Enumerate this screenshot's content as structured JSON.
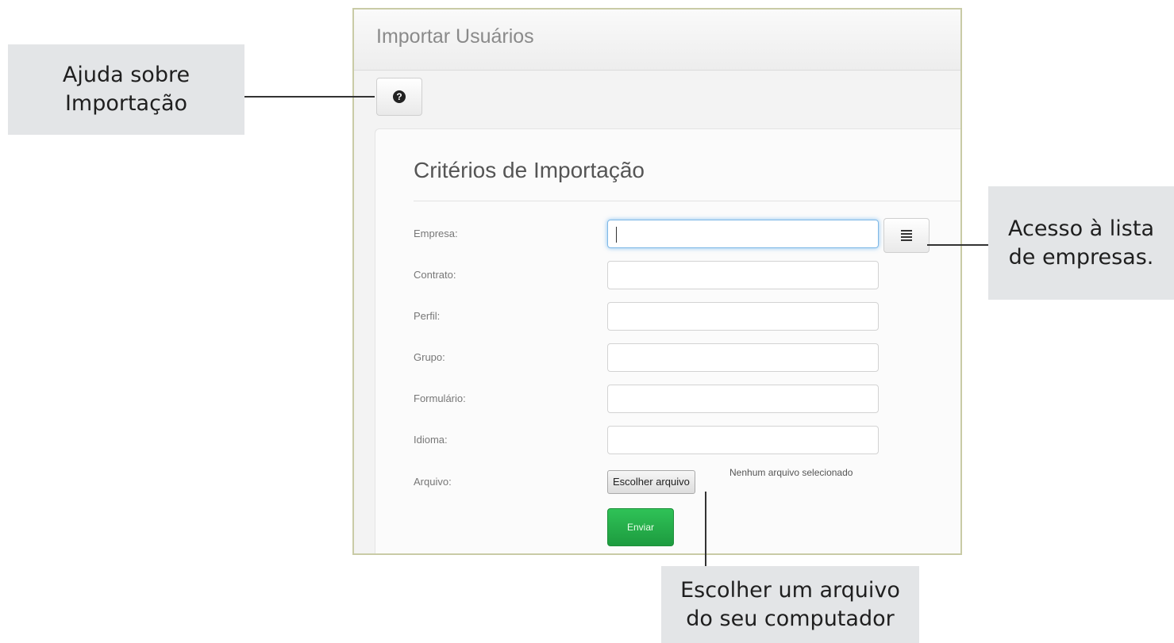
{
  "window": {
    "title": "Importar Usuários"
  },
  "toolbar": {
    "help_icon": "question-circle-icon",
    "help_glyph": "?"
  },
  "form": {
    "section_title": "Critérios de Importação",
    "fields": [
      {
        "label": "Empresa:",
        "value": ""
      },
      {
        "label": "Contrato:",
        "value": ""
      },
      {
        "label": "Perfil:",
        "value": ""
      },
      {
        "label": "Grupo:",
        "value": ""
      },
      {
        "label": "Formulário:",
        "value": ""
      },
      {
        "label": "Idioma:",
        "value": ""
      }
    ],
    "company_list_icon": "list-icon",
    "file_label": "Arquivo:",
    "file_button": "Escolher arquivo",
    "file_status": "Nenhum arquivo selecionado",
    "submit_button": "Enviar",
    "submit_color": "#1d9b3f"
  },
  "callouts": {
    "help": {
      "line1": "Ajuda sobre",
      "line2": "Importação"
    },
    "company_list": {
      "line1": "Acesso à lista",
      "line2": "de empresas."
    },
    "file": {
      "line1": "Escolher um arquivo",
      "line2": "do seu computador"
    }
  }
}
